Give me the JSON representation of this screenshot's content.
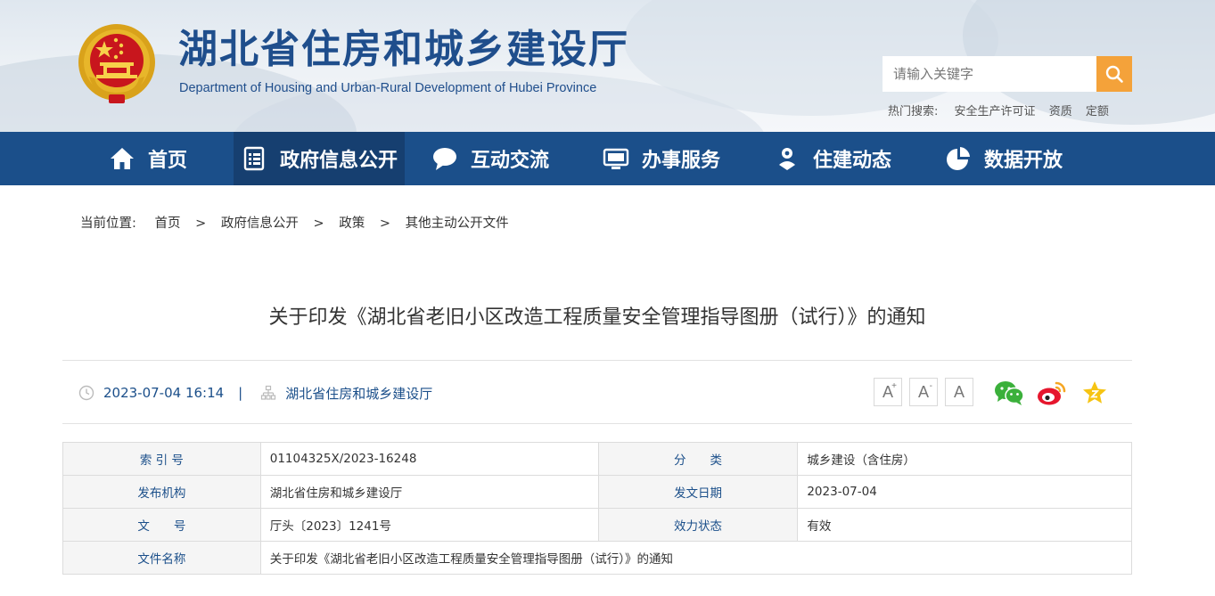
{
  "header": {
    "site_title": "湖北省住房和城乡建设厅",
    "site_subtitle": "Department of Housing and Urban-Rural Development of Hubei Province",
    "search_placeholder": "请输入关键字",
    "hot_search_label": "热门搜索:",
    "hot_search_links": [
      "安全生产许可证",
      "资质",
      "定额"
    ]
  },
  "nav": {
    "items": [
      {
        "label": "首页",
        "icon": "home-icon"
      },
      {
        "label": "政府信息公开",
        "icon": "document-list-icon",
        "active": true
      },
      {
        "label": "互动交流",
        "icon": "chat-bubble-icon"
      },
      {
        "label": "办事服务",
        "icon": "monitor-icon"
      },
      {
        "label": "住建动态",
        "icon": "person-pin-icon"
      },
      {
        "label": "数据开放",
        "icon": "pie-chart-icon"
      }
    ]
  },
  "breadcrumb": {
    "label": "当前位置:",
    "items": [
      "首页",
      "政府信息公开",
      "政策",
      "其他主动公开文件"
    ],
    "separator": ">"
  },
  "article": {
    "title": "关于印发《湖北省老旧小区改造工程质量安全管理指导图册（试行）》的通知",
    "datetime": "2023-07-04 16:14",
    "meta_divider": "|",
    "source": "湖北省住房和城乡建设厅"
  },
  "font_tools": {
    "increase": "A",
    "increase_mark": "+",
    "decrease": "A",
    "decrease_mark": "-",
    "reset": "A"
  },
  "share": [
    "wechat-icon",
    "weibo-icon",
    "favorite-star-icon"
  ],
  "info_table": {
    "rows": [
      [
        {
          "k": "索 引 号",
          "v": "01104325X/2023-16248"
        },
        {
          "k": "分　　类",
          "v": "城乡建设（含住房）"
        }
      ],
      [
        {
          "k": "发布机构",
          "v": "湖北省住房和城乡建设厅"
        },
        {
          "k": "发文日期",
          "v": "2023-07-04"
        }
      ],
      [
        {
          "k": "文　　号",
          "v": "厅头〔2023〕1241号"
        },
        {
          "k": "效力状态",
          "v": "有效"
        }
      ],
      [
        {
          "k": "文件名称",
          "v": "关于印发《湖北省老旧小区改造工程质量安全管理指导图册（试行）》的通知"
        }
      ]
    ]
  },
  "colors": {
    "nav_bg": "#1b4f8a",
    "nav_active": "#163f70",
    "brand_blue": "#1f4e8c",
    "search_button": "#f4a23a"
  }
}
